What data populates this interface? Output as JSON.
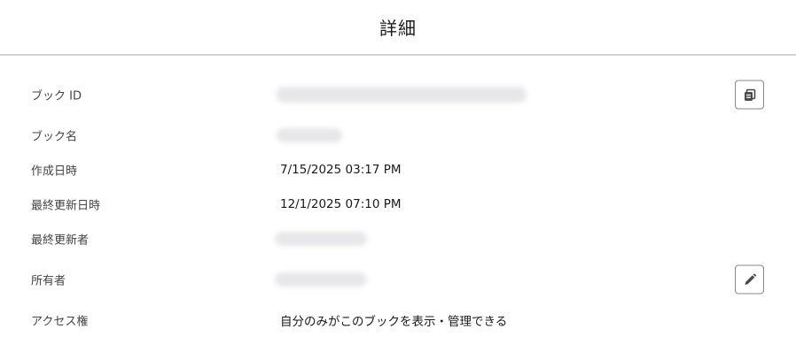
{
  "header": {
    "title": "詳細"
  },
  "details": {
    "book_id": {
      "label": "ブック ID",
      "copy_icon": "copy-icon"
    },
    "book_name": {
      "label": "ブック名"
    },
    "created_at": {
      "label": "作成日時",
      "value": "7/15/2025 03:17 PM"
    },
    "updated_at": {
      "label": "最終更新日時",
      "value": "12/1/2025 07:10 PM"
    },
    "updated_by": {
      "label": "最終更新者"
    },
    "owner": {
      "label": "所有者",
      "edit_icon": "pencil-icon"
    },
    "access": {
      "label": "アクセス権",
      "value": "自分のみがこのブックを表示・管理できる"
    }
  },
  "colors": {
    "divider": "#d2d2d2",
    "button_border": "#8a8a8a",
    "icon": "#4a4a4a"
  }
}
